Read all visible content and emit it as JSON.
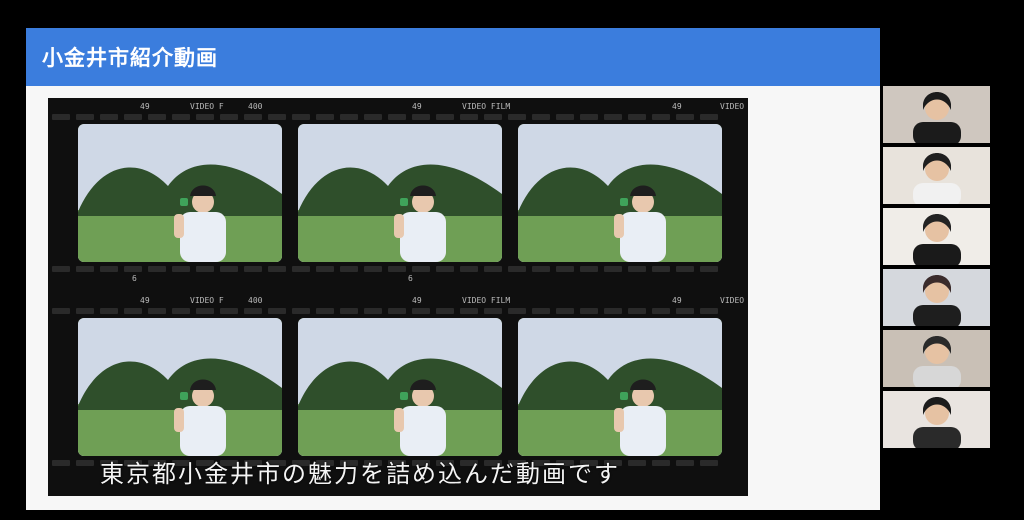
{
  "slide": {
    "title": "小金井市紹介動画"
  },
  "film": {
    "top_marks": [
      "49",
      "VIDEO F",
      "400",
      "49",
      "VIDEO FILM",
      "49",
      "VIDEO"
    ],
    "bottom_marks": [
      "6",
      "6"
    ],
    "second_top_marks": [
      "49",
      "VIDEO F",
      "400",
      "49",
      "VIDEO FILM",
      "49",
      "VIDEO"
    ],
    "frames_count_label": "",
    "subtitle": "東京都小金井市の魅力を詰め込んだ動画です"
  },
  "participants": {
    "tiles": [
      "participant-1",
      "participant-2",
      "participant-3",
      "participant-4",
      "participant-5",
      "participant-6"
    ]
  },
  "colors": {
    "header": "#3b7ddd",
    "slide_bg": "#f7f7f7",
    "film_bg": "#0f0f0f",
    "grass": "#6f9f55",
    "sky": "#cfd8e6"
  }
}
